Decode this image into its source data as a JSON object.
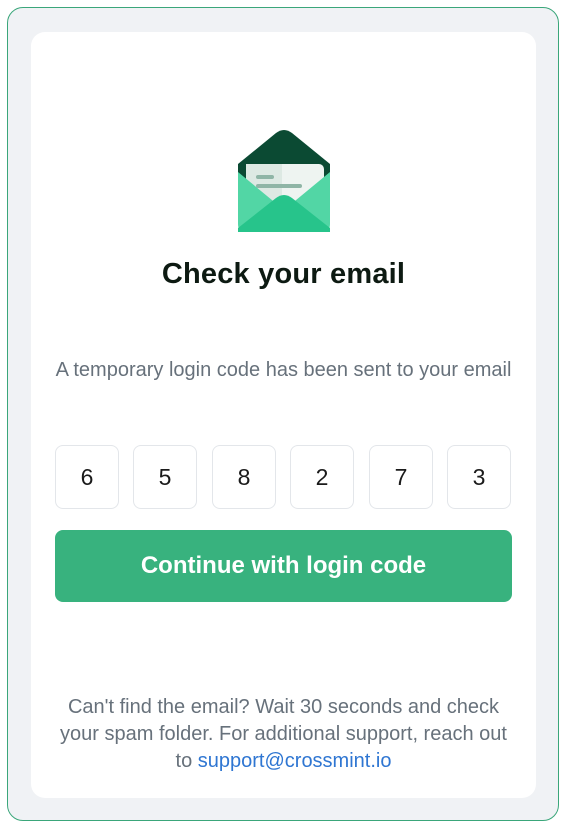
{
  "header": {
    "icon": "envelope-open-icon",
    "title": "Check your email"
  },
  "message": {
    "text": "A temporary login code has been sent to your email"
  },
  "code": {
    "digits": [
      "6",
      "5",
      "8",
      "2",
      "7",
      "3"
    ]
  },
  "continue_button": {
    "label": "Continue with login code"
  },
  "footer": {
    "text": "Can't find the email? Wait 30 seconds and check your spam folder. For additional support, reach out to",
    "support_link": "support@crossmint.io"
  },
  "colors": {
    "accent": "#38b27e",
    "border": "#3aa67a",
    "link": "#2f76d2",
    "text_muted": "#67717b",
    "envelope_dark": "#0b4a33",
    "envelope_light": "#52d6a5",
    "envelope_mid": "#27c48b"
  }
}
